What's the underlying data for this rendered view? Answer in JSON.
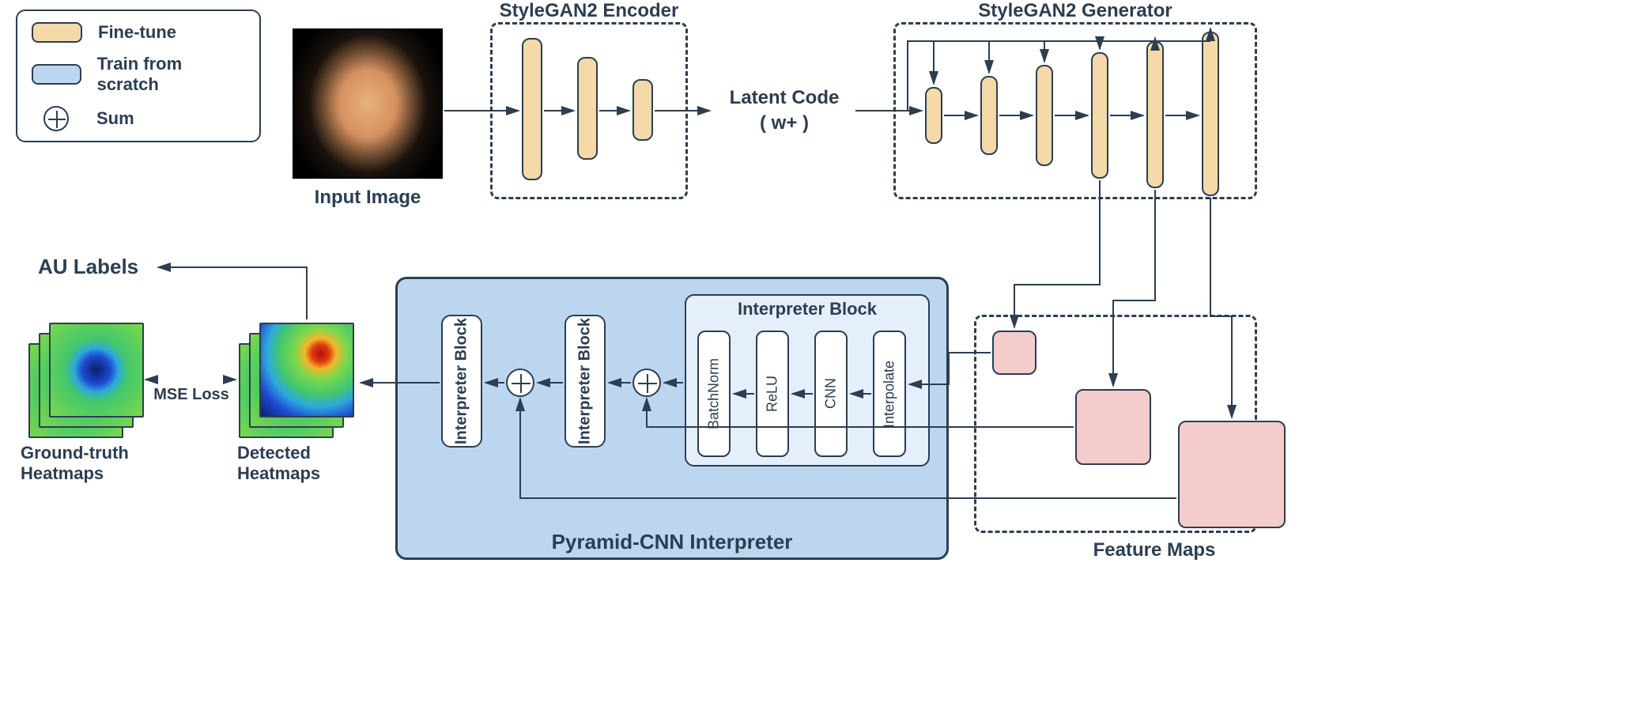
{
  "legend": {
    "fine_tune": "Fine-tune",
    "scratch": "Train from scratch",
    "sum": "Sum"
  },
  "titles": {
    "encoder": "StyleGAN2 Encoder",
    "generator": "StyleGAN2 Generator",
    "interpreter": "Pyramid-CNN Interpreter",
    "feature_maps": "Feature Maps",
    "ib_header": "Interpreter Block"
  },
  "latent": {
    "line1": "Latent Code",
    "line2": "( w+ )"
  },
  "layers": {
    "interpolate": "Interpolate",
    "cnn": "CNN",
    "relu": "ReLU",
    "batchnorm": "BatchNorm"
  },
  "blocks": {
    "ib_small": "Interpreter Block"
  },
  "io": {
    "input_image": "Input Image",
    "gt": "Ground-truth Heatmaps",
    "det": "Detected Heatmaps",
    "mse": "MSE Loss",
    "au": "AU Labels"
  }
}
